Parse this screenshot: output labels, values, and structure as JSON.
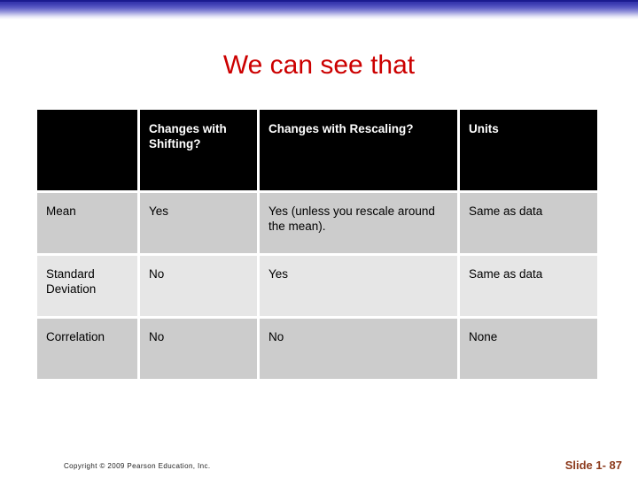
{
  "slide": {
    "title": "We can see that",
    "title_color": "#CC0000",
    "accent_bar_color": "#2F2FA8"
  },
  "table": {
    "columns": [
      "",
      "Changes with Shifting?",
      "Changes with Rescaling?",
      "Units"
    ],
    "column_0_header": "",
    "column_1_header": "Changes with Shifting?",
    "column_2_header": "Changes with Rescaling?",
    "column_3_header": "Units",
    "rows": [
      {
        "label": "Mean",
        "shifting": "Yes",
        "rescaling": "Yes (unless you rescale around the mean).",
        "units": "Same as data"
      },
      {
        "label": "Standard Deviation",
        "shifting": "No",
        "rescaling": "Yes",
        "units": "Same as data"
      },
      {
        "label": "Correlation",
        "shifting": "No",
        "rescaling": "No",
        "units": "None"
      }
    ]
  },
  "footer": {
    "copyright": "Copyright © 2009 Pearson Education, Inc.",
    "slide_number": "Slide 1- 87",
    "slide_number_color": "#8C3A1C"
  }
}
